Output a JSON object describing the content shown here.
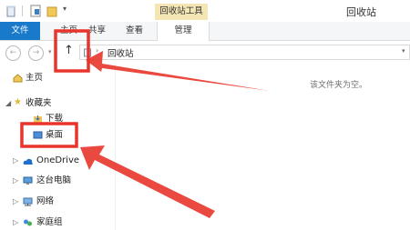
{
  "window": {
    "title": "回收站",
    "tool_tab_header": "回收站工具"
  },
  "ribbon": {
    "tabs": [
      {
        "label": "文件"
      },
      {
        "label": "主页"
      },
      {
        "label": "共享"
      },
      {
        "label": "查看"
      },
      {
        "label": "管理"
      }
    ]
  },
  "address": {
    "path": "回收站"
  },
  "nav": {
    "items": [
      {
        "label": "主页"
      },
      {
        "label": "收藏夹"
      },
      {
        "label": "下载"
      },
      {
        "label": "桌面"
      },
      {
        "label": "OneDrive"
      },
      {
        "label": "这台电脑"
      },
      {
        "label": "网络"
      },
      {
        "label": "家庭组"
      }
    ]
  },
  "content": {
    "empty_message": "该文件夹为空。"
  },
  "colors": {
    "accent": "#1979ca",
    "tool_tab": "#f4e6b4",
    "highlight": "#e8352b",
    "arrow": "#e8352b"
  },
  "icons": [
    "recycle-bin-icon",
    "properties-icon",
    "new-folder-icon",
    "back-arrow-icon",
    "forward-arrow-icon",
    "up-arrow-icon",
    "home-icon",
    "star-icon",
    "download-icon",
    "desktop-icon",
    "cloud-icon",
    "computer-icon",
    "network-icon",
    "homegroup-icon"
  ]
}
